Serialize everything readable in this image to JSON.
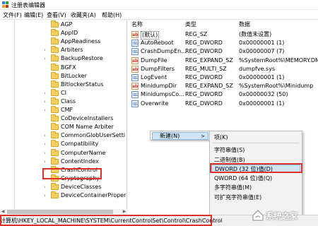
{
  "window": {
    "title": "注册表编辑器"
  },
  "menu": [
    "文件(F)",
    "编辑(E)",
    "查看(V)",
    "收藏夹(A)",
    "帮助(H)"
  ],
  "tree": {
    "items": [
      {
        "label": "AGP",
        "expandable": false
      },
      {
        "label": "AppID",
        "expandable": false
      },
      {
        "label": "AppReadiness",
        "expandable": false
      },
      {
        "label": "Arbiters",
        "expandable": true
      },
      {
        "label": "BackupRestore",
        "expandable": true
      },
      {
        "label": "BGFX",
        "expandable": false
      },
      {
        "label": "BitLocker",
        "expandable": false
      },
      {
        "label": "BitlockerStatus",
        "expandable": false
      },
      {
        "label": "CI",
        "expandable": true
      },
      {
        "label": "Class",
        "expandable": true
      },
      {
        "label": "CMF",
        "expandable": true
      },
      {
        "label": "CoDeviceInstallers",
        "expandable": false
      },
      {
        "label": "COM Name Arbiter",
        "expandable": false
      },
      {
        "label": "CommonGlobUserSetti",
        "expandable": true
      },
      {
        "label": "Compatibility",
        "expandable": true
      },
      {
        "label": "ComputerName",
        "expandable": true
      },
      {
        "label": "ContentIndex",
        "expandable": true
      },
      {
        "label": "CrashControl",
        "expandable": true,
        "selected": true
      },
      {
        "label": "Cryptography",
        "expandable": true
      },
      {
        "label": "DeviceClasses",
        "expandable": true
      },
      {
        "label": "DeviceContainerProper",
        "expandable": true
      }
    ]
  },
  "values": {
    "headers": {
      "name": "名称",
      "type": "类型",
      "data": "数据"
    },
    "rows": [
      {
        "icon": "ab",
        "name": "(默认)",
        "type": "REG_SZ",
        "data": "(数值未设置)"
      },
      {
        "icon": "bin",
        "name": "AutoReboot",
        "type": "REG_DWORD",
        "data": "0x00000001 (1)"
      },
      {
        "icon": "bin",
        "name": "CrashDumpEn...",
        "type": "REG_DWORD",
        "data": "0x00000007 (7)"
      },
      {
        "icon": "ab",
        "name": "DumpFile",
        "type": "REG_EXPAND_SZ",
        "data": "%SystemRoot%\\MEMORY.DMP"
      },
      {
        "icon": "ab",
        "name": "DumpFilters",
        "type": "REG_MULTI_SZ",
        "data": "dumpfve.sys"
      },
      {
        "icon": "bin",
        "name": "LogEvent",
        "type": "REG_DWORD",
        "data": "0x00000001 (1)"
      },
      {
        "icon": "ab",
        "name": "MinidumpDir",
        "type": "REG_EXPAND_SZ",
        "data": "%SystemRoot%\\Minidump"
      },
      {
        "icon": "bin",
        "name": "MinidumpsCo...",
        "type": "REG_DWORD",
        "data": "0x00000032 (50)"
      },
      {
        "icon": "bin",
        "name": "Overwrite",
        "type": "REG_DWORD",
        "data": "0x00000001 (1)"
      }
    ]
  },
  "context_menu": {
    "new_label": "新建(N)",
    "arrow": ">"
  },
  "submenu": {
    "items": [
      {
        "label": "项(K)"
      },
      {
        "label": "字符串值(S)"
      },
      {
        "label": "二进制值(B)"
      },
      {
        "label": "DWORD (32 位)值(D)",
        "highlighted": true
      },
      {
        "label": "QWORD (64 位)值(Q)"
      },
      {
        "label": "多字符串值(M)"
      },
      {
        "label": "可扩充字符串值(E)"
      }
    ]
  },
  "status": {
    "path": "计算机\\HKEY_LOCAL_MACHINE\\SYSTEM\\CurrentControlSet\\Control\\CrashControl"
  },
  "watermark": {
    "text": "系统之家"
  },
  "colors": {
    "highlight_border": "#e0302a",
    "menu_highlight": "#cfe4f8",
    "folder": "#f3cf63"
  }
}
